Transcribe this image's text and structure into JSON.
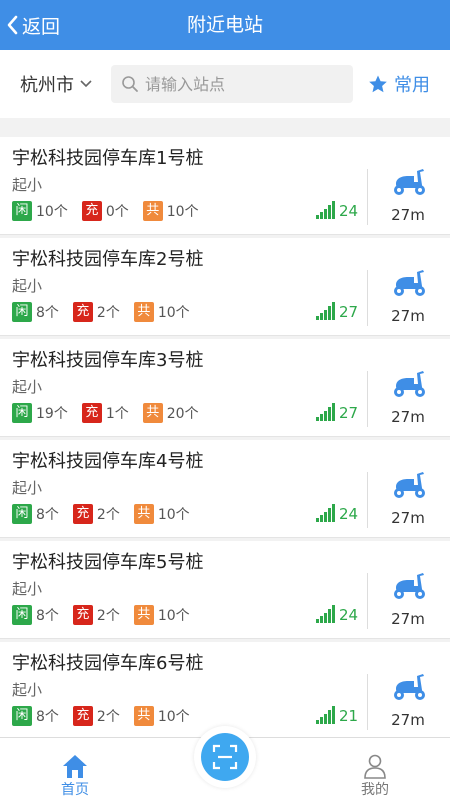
{
  "header": {
    "back_label": "返回",
    "title": "附近电站"
  },
  "search": {
    "city": "杭州市",
    "placeholder": "请输入站点",
    "favorites_label": "常用"
  },
  "legend": {
    "idle": "闲",
    "charging": "充",
    "total": "共"
  },
  "stations": [
    {
      "name": "宇松科技园停车库1号桩",
      "sub": "起小",
      "idle": "10个",
      "charging": "0个",
      "total": "10个",
      "signal": "24",
      "distance": "27m"
    },
    {
      "name": "宇松科技园停车库2号桩",
      "sub": "起小",
      "idle": "8个",
      "charging": "2个",
      "total": "10个",
      "signal": "27",
      "distance": "27m"
    },
    {
      "name": "宇松科技园停车库3号桩",
      "sub": "起小",
      "idle": "19个",
      "charging": "1个",
      "total": "20个",
      "signal": "27",
      "distance": "27m"
    },
    {
      "name": "宇松科技园停车库4号桩",
      "sub": "起小",
      "idle": "8个",
      "charging": "2个",
      "total": "10个",
      "signal": "24",
      "distance": "27m"
    },
    {
      "name": "宇松科技园停车库5号桩",
      "sub": "起小",
      "idle": "8个",
      "charging": "2个",
      "total": "10个",
      "signal": "24",
      "distance": "27m"
    },
    {
      "name": "宇松科技园停车库6号桩",
      "sub": "起小",
      "idle": "8个",
      "charging": "2个",
      "total": "10个",
      "signal": "21",
      "distance": "27m"
    }
  ],
  "tabs": {
    "home": "首页",
    "me": "我的"
  },
  "colors": {
    "primary": "#3f8ee6",
    "idle": "#2da84a",
    "charging": "#d7261b",
    "total": "#f08a3c",
    "scan": "#3fa8f0"
  },
  "icons": {
    "back": "chevron-left-icon",
    "city": "chevron-down-icon",
    "search": "search-icon",
    "favorites": "star-icon",
    "signal": "signal-bars-icon",
    "vehicle": "scooter-icon",
    "home": "home-icon",
    "scan": "scan-icon",
    "me": "user-icon"
  }
}
